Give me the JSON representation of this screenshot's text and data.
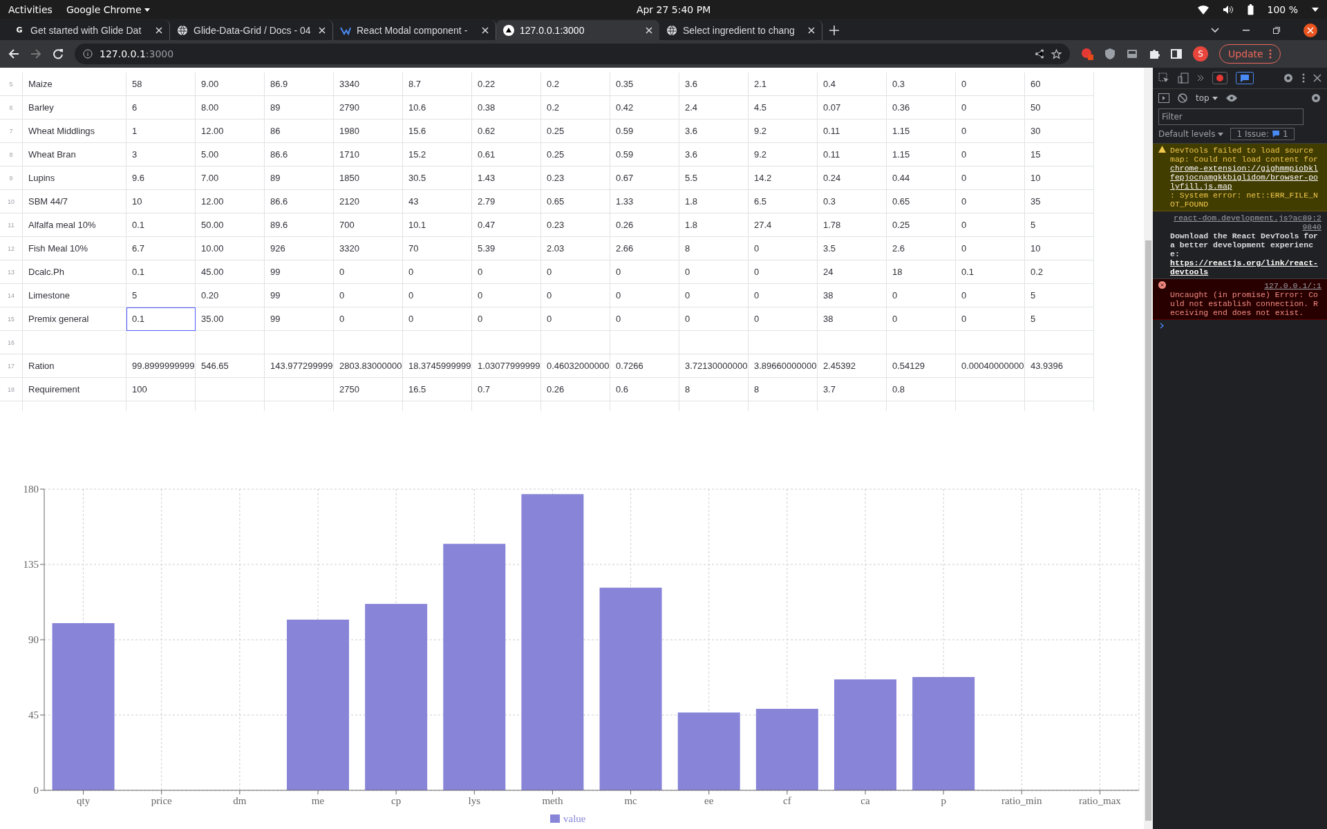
{
  "top_bar": {
    "activities": "Activities",
    "app_menu": "Google Chrome",
    "clock": "Apr 27  5:40 PM",
    "battery": "100 %"
  },
  "tabs": [
    {
      "kind": "letter",
      "badge": "G",
      "title": "Get started with Glide Dat",
      "selected": false
    },
    {
      "kind": "globe",
      "title": "Glide-Data-Grid / Docs - 04",
      "selected": false
    },
    {
      "kind": "modal",
      "title": "React Modal component -",
      "selected": false
    },
    {
      "kind": "triangle",
      "title": "127.0.0.1:3000",
      "selected": true
    },
    {
      "kind": "globe",
      "title": "Select ingredient to chang",
      "selected": false
    }
  ],
  "address_bar": {
    "host": "127.0.0.1",
    "port": ":3000",
    "profile": "S",
    "update_button": "Update"
  },
  "table": {
    "rows": [
      {
        "number": "5",
        "cells": [
          {
            "text": "Maize",
            "selected": false
          },
          {
            "text": "58",
            "selected": false
          },
          {
            "text": "9.00",
            "selected": false
          },
          {
            "text": "86.9",
            "selected": false
          },
          {
            "text": "3340",
            "selected": false
          },
          {
            "text": "8.7",
            "selected": false
          },
          {
            "text": "0.22",
            "selected": false
          },
          {
            "text": "0.2",
            "selected": false
          },
          {
            "text": "0.35",
            "selected": false
          },
          {
            "text": "3.6",
            "selected": false
          },
          {
            "text": "2.1",
            "selected": false
          },
          {
            "text": "0.4",
            "selected": false
          },
          {
            "text": "0.3",
            "selected": false
          },
          {
            "text": "0",
            "selected": false
          },
          {
            "text": "60",
            "selected": false
          }
        ]
      },
      {
        "number": "6",
        "cells": [
          {
            "text": "Barley",
            "selected": false
          },
          {
            "text": "6",
            "selected": false
          },
          {
            "text": "8.00",
            "selected": false
          },
          {
            "text": "89",
            "selected": false
          },
          {
            "text": "2790",
            "selected": false
          },
          {
            "text": "10.6",
            "selected": false
          },
          {
            "text": "0.38",
            "selected": false
          },
          {
            "text": "0.2",
            "selected": false
          },
          {
            "text": "0.42",
            "selected": false
          },
          {
            "text": "2.4",
            "selected": false
          },
          {
            "text": "4.5",
            "selected": false
          },
          {
            "text": "0.07",
            "selected": false
          },
          {
            "text": "0.36",
            "selected": false
          },
          {
            "text": "0",
            "selected": false
          },
          {
            "text": "50",
            "selected": false
          }
        ]
      },
      {
        "number": "7",
        "cells": [
          {
            "text": "Wheat Middlings",
            "selected": false
          },
          {
            "text": "1",
            "selected": false
          },
          {
            "text": "12.00",
            "selected": false
          },
          {
            "text": "86",
            "selected": false
          },
          {
            "text": "1980",
            "selected": false
          },
          {
            "text": "15.6",
            "selected": false
          },
          {
            "text": "0.62",
            "selected": false
          },
          {
            "text": "0.25",
            "selected": false
          },
          {
            "text": "0.59",
            "selected": false
          },
          {
            "text": "3.6",
            "selected": false
          },
          {
            "text": "9.2",
            "selected": false
          },
          {
            "text": "0.11",
            "selected": false
          },
          {
            "text": "1.15",
            "selected": false
          },
          {
            "text": "0",
            "selected": false
          },
          {
            "text": "30",
            "selected": false
          }
        ]
      },
      {
        "number": "8",
        "cells": [
          {
            "text": "Wheat Bran",
            "selected": false
          },
          {
            "text": "3",
            "selected": false
          },
          {
            "text": "5.00",
            "selected": false
          },
          {
            "text": "86.6",
            "selected": false
          },
          {
            "text": "1710",
            "selected": false
          },
          {
            "text": "15.2",
            "selected": false
          },
          {
            "text": "0.61",
            "selected": false
          },
          {
            "text": "0.25",
            "selected": false
          },
          {
            "text": "0.59",
            "selected": false
          },
          {
            "text": "3.6",
            "selected": false
          },
          {
            "text": "9.2",
            "selected": false
          },
          {
            "text": "0.11",
            "selected": false
          },
          {
            "text": "1.15",
            "selected": false
          },
          {
            "text": "0",
            "selected": false
          },
          {
            "text": "15",
            "selected": false
          }
        ]
      },
      {
        "number": "9",
        "cells": [
          {
            "text": "Lupins",
            "selected": false
          },
          {
            "text": "9.6",
            "selected": false
          },
          {
            "text": "7.00",
            "selected": false
          },
          {
            "text": "89",
            "selected": false
          },
          {
            "text": "1850",
            "selected": false
          },
          {
            "text": "30.5",
            "selected": false
          },
          {
            "text": "1.43",
            "selected": false
          },
          {
            "text": "0.23",
            "selected": false
          },
          {
            "text": "0.67",
            "selected": false
          },
          {
            "text": "5.5",
            "selected": false
          },
          {
            "text": "14.2",
            "selected": false
          },
          {
            "text": "0.24",
            "selected": false
          },
          {
            "text": "0.44",
            "selected": false
          },
          {
            "text": "0",
            "selected": false
          },
          {
            "text": "10",
            "selected": false
          }
        ]
      },
      {
        "number": "10",
        "cells": [
          {
            "text": "SBM 44/7",
            "selected": false
          },
          {
            "text": "10",
            "selected": false
          },
          {
            "text": "12.00",
            "selected": false
          },
          {
            "text": "86.6",
            "selected": false
          },
          {
            "text": "2120",
            "selected": false
          },
          {
            "text": "43",
            "selected": false
          },
          {
            "text": "2.79",
            "selected": false
          },
          {
            "text": "0.65",
            "selected": false
          },
          {
            "text": "1.33",
            "selected": false
          },
          {
            "text": "1.8",
            "selected": false
          },
          {
            "text": "6.5",
            "selected": false
          },
          {
            "text": "0.3",
            "selected": false
          },
          {
            "text": "0.65",
            "selected": false
          },
          {
            "text": "0",
            "selected": false
          },
          {
            "text": "35",
            "selected": false
          }
        ]
      },
      {
        "number": "11",
        "cells": [
          {
            "text": "Alfalfa meal 10%",
            "selected": false
          },
          {
            "text": "0.1",
            "selected": false
          },
          {
            "text": "50.00",
            "selected": false
          },
          {
            "text": "89.6",
            "selected": false
          },
          {
            "text": "700",
            "selected": false
          },
          {
            "text": "10.1",
            "selected": false
          },
          {
            "text": "0.47",
            "selected": false
          },
          {
            "text": "0.23",
            "selected": false
          },
          {
            "text": "0.26",
            "selected": false
          },
          {
            "text": "1.8",
            "selected": false
          },
          {
            "text": "27.4",
            "selected": false
          },
          {
            "text": "1.78",
            "selected": false
          },
          {
            "text": "0.25",
            "selected": false
          },
          {
            "text": "0",
            "selected": false
          },
          {
            "text": "5",
            "selected": false
          }
        ]
      },
      {
        "number": "12",
        "cells": [
          {
            "text": "Fish Meal 10%",
            "selected": false
          },
          {
            "text": "6.7",
            "selected": false
          },
          {
            "text": "10.00",
            "selected": false
          },
          {
            "text": "926",
            "selected": false
          },
          {
            "text": "3320",
            "selected": false
          },
          {
            "text": "70",
            "selected": false
          },
          {
            "text": "5.39",
            "selected": false
          },
          {
            "text": "2.03",
            "selected": false
          },
          {
            "text": "2.66",
            "selected": false
          },
          {
            "text": "8",
            "selected": false
          },
          {
            "text": "0",
            "selected": false
          },
          {
            "text": "3.5",
            "selected": false
          },
          {
            "text": "2.6",
            "selected": false
          },
          {
            "text": "0",
            "selected": false
          },
          {
            "text": "10",
            "selected": false
          }
        ]
      },
      {
        "number": "13",
        "cells": [
          {
            "text": "Dcalc.Ph",
            "selected": false
          },
          {
            "text": "0.1",
            "selected": false
          },
          {
            "text": "45.00",
            "selected": false
          },
          {
            "text": "99",
            "selected": false
          },
          {
            "text": "0",
            "selected": false
          },
          {
            "text": "0",
            "selected": false
          },
          {
            "text": "0",
            "selected": false
          },
          {
            "text": "0",
            "selected": false
          },
          {
            "text": "0",
            "selected": false
          },
          {
            "text": "0",
            "selected": false
          },
          {
            "text": "0",
            "selected": false
          },
          {
            "text": "24",
            "selected": false
          },
          {
            "text": "18",
            "selected": false
          },
          {
            "text": "0.1",
            "selected": false
          },
          {
            "text": "0.2",
            "selected": false
          }
        ]
      },
      {
        "number": "14",
        "cells": [
          {
            "text": "Limestone",
            "selected": false
          },
          {
            "text": "5",
            "selected": false
          },
          {
            "text": "0.20",
            "selected": false
          },
          {
            "text": "99",
            "selected": false
          },
          {
            "text": "0",
            "selected": false
          },
          {
            "text": "0",
            "selected": false
          },
          {
            "text": "0",
            "selected": false
          },
          {
            "text": "0",
            "selected": false
          },
          {
            "text": "0",
            "selected": false
          },
          {
            "text": "0",
            "selected": false
          },
          {
            "text": "0",
            "selected": false
          },
          {
            "text": "38",
            "selected": false
          },
          {
            "text": "0",
            "selected": false
          },
          {
            "text": "0",
            "selected": false
          },
          {
            "text": "5",
            "selected": false
          }
        ]
      },
      {
        "number": "15",
        "cells": [
          {
            "text": "Premix general",
            "selected": false
          },
          {
            "text": "0.1",
            "selected": true
          },
          {
            "text": "35.00",
            "selected": false
          },
          {
            "text": "99",
            "selected": false
          },
          {
            "text": "0",
            "selected": false
          },
          {
            "text": "0",
            "selected": false
          },
          {
            "text": "0",
            "selected": false
          },
          {
            "text": "0",
            "selected": false
          },
          {
            "text": "0",
            "selected": false
          },
          {
            "text": "0",
            "selected": false
          },
          {
            "text": "0",
            "selected": false
          },
          {
            "text": "38",
            "selected": false
          },
          {
            "text": "0",
            "selected": false
          },
          {
            "text": "0",
            "selected": false
          },
          {
            "text": "5",
            "selected": false
          }
        ]
      },
      {
        "number": "16",
        "cells": [
          {
            "selected": false
          },
          {
            "selected": false
          },
          {
            "selected": false
          },
          {
            "selected": false
          },
          {
            "selected": false
          },
          {
            "selected": false
          },
          {
            "selected": false
          },
          {
            "selected": false
          },
          {
            "selected": false
          },
          {
            "selected": false
          },
          {
            "selected": false
          },
          {
            "selected": false
          },
          {
            "selected": false
          },
          {
            "selected": false
          },
          {
            "selected": false
          }
        ]
      },
      {
        "number": "17",
        "cells": [
          {
            "text": "Ration",
            "selected": false
          },
          {
            "text": "99.8999999999",
            "selected": false
          },
          {
            "text": "546.65",
            "selected": false
          },
          {
            "text": "143.977299999",
            "selected": false
          },
          {
            "text": "2803.83000000",
            "selected": false
          },
          {
            "text": "18.3745999999",
            "selected": false
          },
          {
            "text": "1.03077999999",
            "selected": false
          },
          {
            "text": "0.46032000000",
            "selected": false
          },
          {
            "text": "0.7266",
            "selected": false
          },
          {
            "text": "3.72130000000",
            "selected": false
          },
          {
            "text": "3.89660000000",
            "selected": false
          },
          {
            "text": "2.45392",
            "selected": false
          },
          {
            "text": "0.54129",
            "selected": false
          },
          {
            "text": "0.00040000000",
            "selected": false
          },
          {
            "text": "43.9396",
            "selected": false
          }
        ]
      },
      {
        "number": "18",
        "cells": [
          {
            "text": "Requirement",
            "selected": false
          },
          {
            "text": "100",
            "selected": false
          },
          {
            "selected": false
          },
          {
            "selected": false
          },
          {
            "text": "2750",
            "selected": false
          },
          {
            "text": "16.5",
            "selected": false
          },
          {
            "text": "0.7",
            "selected": false
          },
          {
            "text": "0.26",
            "selected": false
          },
          {
            "text": "0.6",
            "selected": false
          },
          {
            "text": "8",
            "selected": false
          },
          {
            "text": "8",
            "selected": false
          },
          {
            "text": "3.7",
            "selected": false
          },
          {
            "text": "0.8",
            "selected": false
          },
          {
            "selected": false
          },
          {
            "selected": false
          }
        ]
      }
    ]
  },
  "chart_data": {
    "type": "bar",
    "categories": [
      "qty",
      "price",
      "dm",
      "me",
      "cp",
      "lys",
      "meth",
      "mc",
      "ee",
      "cf",
      "ca",
      "p",
      "ratio_min",
      "ratio_max"
    ],
    "series": [
      {
        "name": "value",
        "color": "#8884d8",
        "values": [
          99.9,
          0,
          0,
          102,
          111.4,
          147.3,
          177,
          121.1,
          46.5,
          48.7,
          66.3,
          67.7,
          0,
          0
        ]
      }
    ],
    "grid": true,
    "ylim": [
      0,
      180
    ],
    "yticks": [
      0,
      45,
      90,
      135,
      180
    ]
  },
  "devtools": {
    "context": "top",
    "filter_placeholder": "Filter",
    "levels": "Default levels",
    "issues_label": "1 Issue:",
    "issues_count": "1",
    "messages": [
      {
        "kind": "warning",
        "parts": [
          {
            "text": "DevTools failed to load source map: Could not load content for ",
            "link": false
          },
          {
            "text": "chrome-extension://gighmmpiobklfepjocnamgkkbiglidom/browser-polyfill.js.map",
            "link": true
          },
          {
            "text": ": System error: net::ERR_FILE_NOT_FOUND",
            "link": false
          }
        ]
      },
      {
        "kind": "info",
        "source": "react-dom.development.js?ac89:29840",
        "parts": [
          {
            "text": "Download the React DevTools for a better development experience: ",
            "link": false
          },
          {
            "text": "https://reactjs.org/link/react-devtools",
            "link": true
          }
        ]
      },
      {
        "kind": "error",
        "source": "127.0.0.1/:1",
        "parts": [
          {
            "text": "Uncaught (in promise) Error: Could not establish connection. Receiving end does not exist.",
            "link": false
          }
        ]
      }
    ]
  }
}
